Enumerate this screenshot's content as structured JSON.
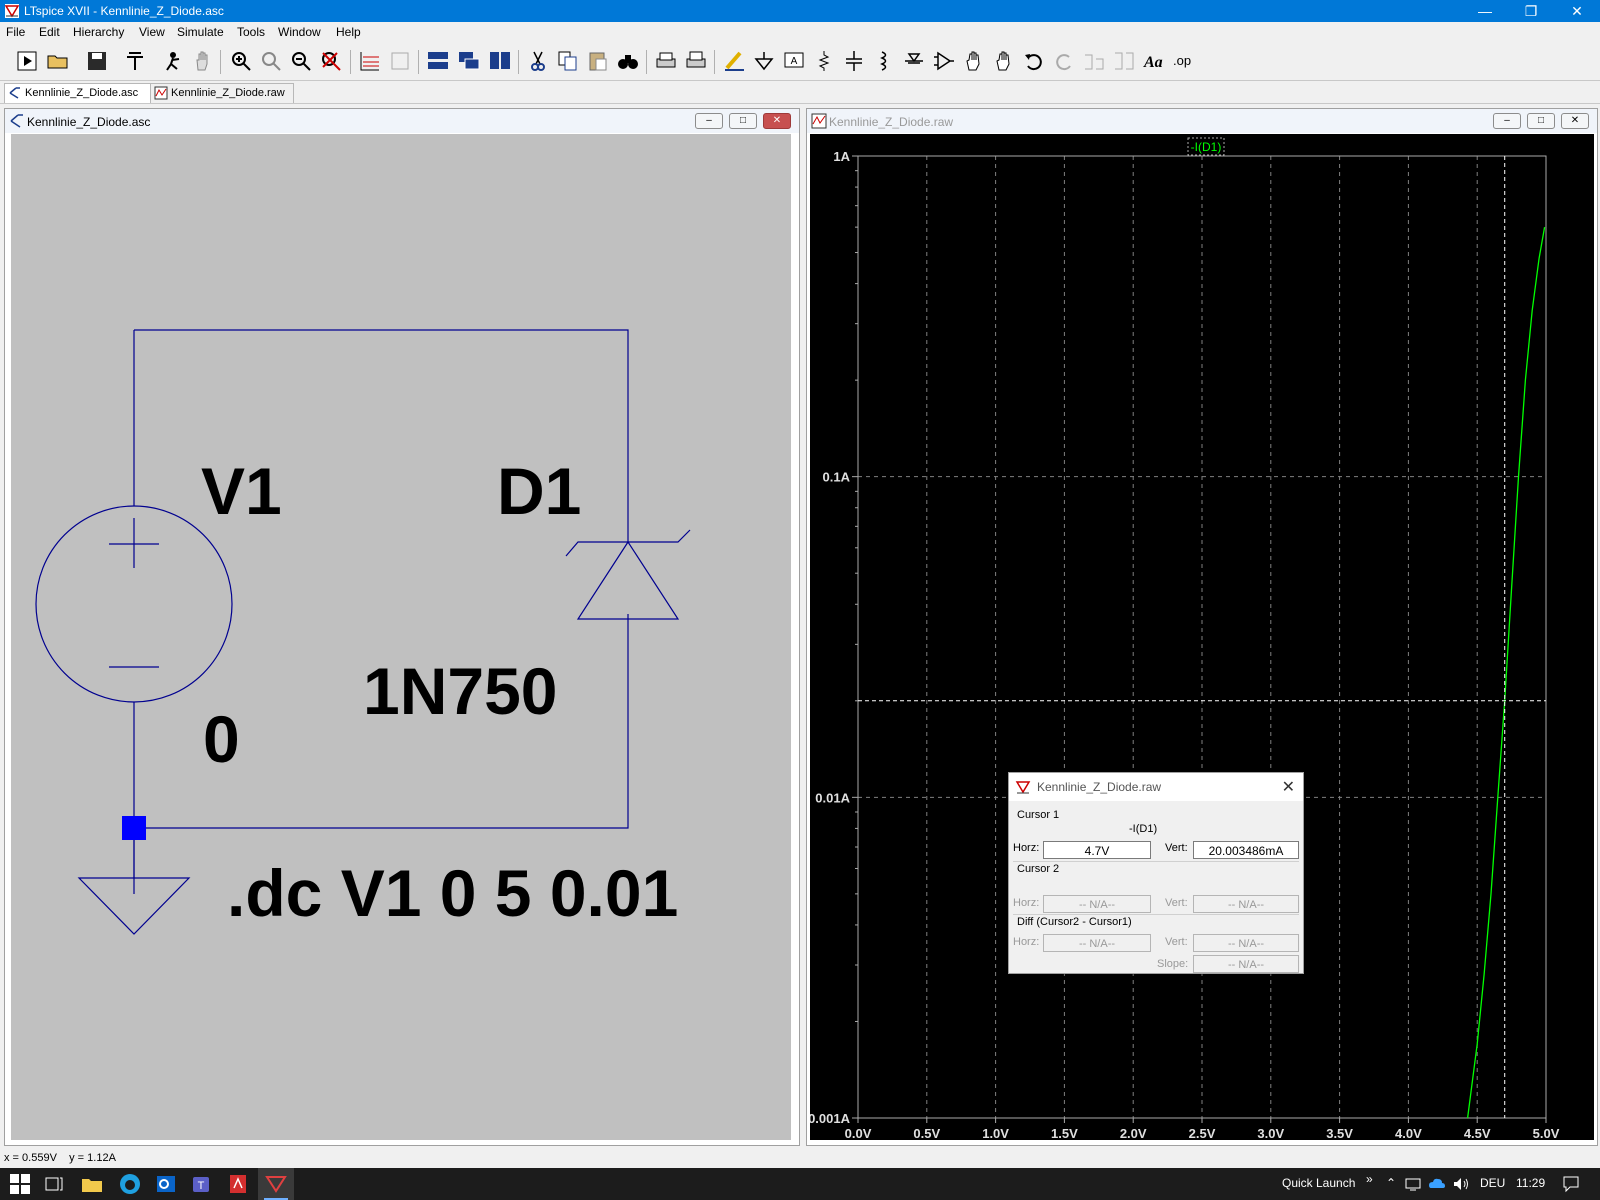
{
  "app": {
    "title": "LTspice XVII - Kennlinie_Z_Diode.asc"
  },
  "menu": [
    "File",
    "Edit",
    "Hierarchy",
    "View",
    "Simulate",
    "Tools",
    "Window",
    "Help"
  ],
  "tabs": [
    {
      "label": "Kennlinie_Z_Diode.asc"
    },
    {
      "label": "Kennlinie_Z_Diode.raw"
    }
  ],
  "schematic_window": {
    "title": "Kennlinie_Z_Diode.asc",
    "labels": {
      "source": "V1",
      "diode": "D1",
      "diode_model": "1N750",
      "source_value": "0",
      "directive": ".dc V1 0 5 0.01"
    }
  },
  "plot_window": {
    "title": "Kennlinie_Z_Diode.raw",
    "trace_label": "-I(D1)"
  },
  "chart_data": {
    "type": "line",
    "title": "",
    "xlabel": "",
    "ylabel": "",
    "y_scale": "log",
    "xlim": [
      0.0,
      5.0
    ],
    "ylim": [
      0.001,
      1.0
    ],
    "x_ticks": [
      "0.0V",
      "0.5V",
      "1.0V",
      "1.5V",
      "2.0V",
      "2.5V",
      "3.0V",
      "3.5V",
      "4.0V",
      "4.5V",
      "5.0V"
    ],
    "y_ticks": [
      "1A",
      "0.1A",
      "0.01A",
      "0.001A"
    ],
    "grid": true,
    "series": [
      {
        "name": "-I(D1)",
        "color": "#00ff00",
        "x": [
          4.43,
          4.5,
          4.55,
          4.6,
          4.65,
          4.7,
          4.75,
          4.8,
          4.85,
          4.9,
          4.95,
          4.99
        ],
        "y": [
          0.001,
          0.0017,
          0.0028,
          0.005,
          0.01,
          0.02,
          0.045,
          0.1,
          0.2,
          0.33,
          0.48,
          0.6
        ]
      }
    ],
    "cursor": {
      "x": 4.7,
      "y": 0.020003486
    }
  },
  "cursor_dialog": {
    "title": "Kennlinie_Z_Diode.raw",
    "cursor1_label": "Cursor 1",
    "trace": "-I(D1)",
    "horz_label": "Horz:",
    "vert_label": "Vert:",
    "cursor1_horz": "4.7V",
    "cursor1_vert": "20.003486mA",
    "cursor2_label": "Cursor 2",
    "cursor2_horz": "-- N/A--",
    "cursor2_vert": "-- N/A--",
    "diff_label": "Diff (Cursor2 - Cursor1)",
    "diff_horz": "-- N/A--",
    "diff_vert": "-- N/A--",
    "slope_label": "Slope:",
    "diff_slope": "-- N/A--"
  },
  "status": {
    "coords": "x = 0.559V    y = 1.12A"
  },
  "taskbar": {
    "quick_launch": "Quick Launch",
    "lang": "DEU",
    "time": "11:29"
  }
}
